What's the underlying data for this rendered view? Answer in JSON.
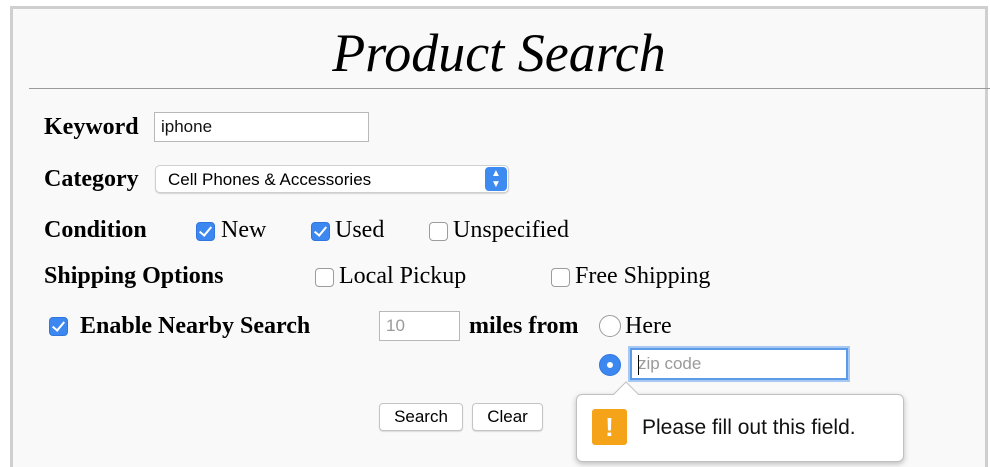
{
  "form": {
    "title": "Product Search",
    "keyword": {
      "label": "Keyword",
      "value": "iphone"
    },
    "category": {
      "label": "Category",
      "selected": "Cell Phones & Accessories"
    },
    "condition": {
      "label": "Condition",
      "options": [
        {
          "label": "New",
          "checked": true
        },
        {
          "label": "Used",
          "checked": true
        },
        {
          "label": "Unspecified",
          "checked": false
        }
      ]
    },
    "shipping": {
      "label": "Shipping Options",
      "options": [
        {
          "label": "Local Pickup",
          "checked": false
        },
        {
          "label": "Free Shipping",
          "checked": false
        }
      ]
    },
    "nearby": {
      "label": "Enable Nearby Search",
      "enabled": true,
      "distance_placeholder": "10",
      "miles_from_label": "miles from",
      "here_label": "Here",
      "here_selected": false,
      "zip_selected": true,
      "zip_placeholder": "zip code"
    },
    "buttons": {
      "search": "Search",
      "clear": "Clear"
    },
    "validation": {
      "icon": "warning-icon",
      "glyph": "!",
      "message": "Please fill out this field."
    }
  }
}
